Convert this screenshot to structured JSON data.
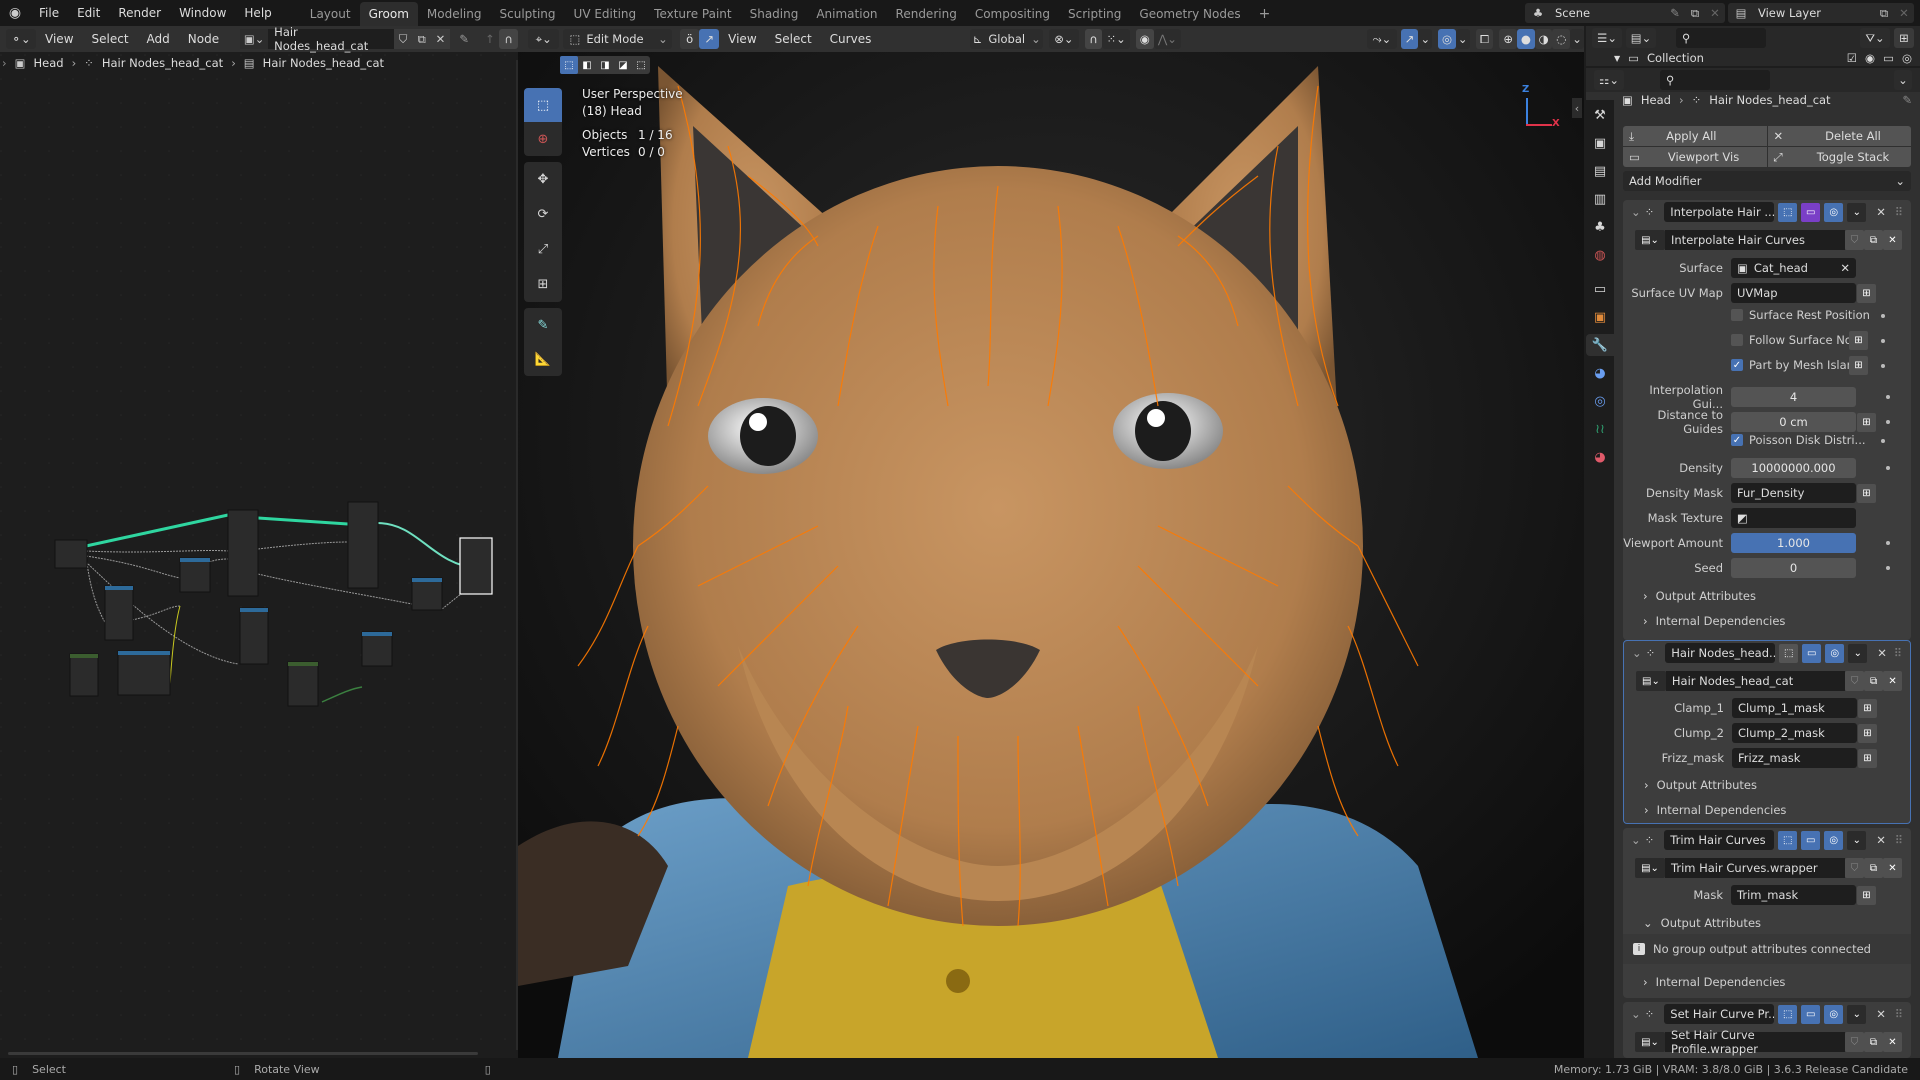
{
  "topbar": {
    "menus": [
      "File",
      "Edit",
      "Render",
      "Window",
      "Help"
    ],
    "workspaces": [
      "Layout",
      "Groom",
      "Modeling",
      "Sculpting",
      "UV Editing",
      "Texture Paint",
      "Shading",
      "Animation",
      "Rendering",
      "Compositing",
      "Scripting",
      "Geometry Nodes"
    ],
    "active_workspace": "Groom",
    "add_workspace": "+",
    "scene": "Scene",
    "view_layer": "View Layer"
  },
  "node_editor": {
    "menus": [
      "View",
      "Select",
      "Add",
      "Node"
    ],
    "node_group": "Hair Nodes_head_cat",
    "breadcrumb": [
      "Head",
      "Hair Nodes_head_cat",
      "Hair Nodes_head_cat"
    ]
  },
  "viewport": {
    "mode": "Edit Mode",
    "menus": [
      "View",
      "Select",
      "Curves"
    ],
    "orientation": "Global",
    "overlay": {
      "view_name": "User Perspective",
      "object_info": "(18) Head",
      "stats": [
        {
          "label": "Objects",
          "value": "1 / 16"
        },
        {
          "label": "Vertices",
          "value": "0 / 0"
        }
      ]
    },
    "axis": {
      "z": "Z",
      "x": "X"
    },
    "tools": [
      "select-box",
      "cursor",
      "move",
      "rotate",
      "scale",
      "transform",
      "annotate",
      "measure"
    ]
  },
  "outliner": {
    "collection": "Collection",
    "search_placeholder": ""
  },
  "properties": {
    "breadcrumb": [
      "Head",
      "Hair Nodes_head_cat"
    ],
    "actions": {
      "apply_all": "Apply All",
      "delete_all": "Delete All",
      "viewport_vis": "Viewport Vis",
      "toggle_stack": "Toggle Stack",
      "add_modifier": "Add Modifier"
    },
    "modifiers": [
      {
        "name": "Interpolate Hair ...",
        "node_group": "Interpolate Hair Curves",
        "fields": {
          "surface_label": "Surface",
          "surface": "Cat_head",
          "uvmap_label": "Surface UV Map",
          "uvmap": "UVMap",
          "rest_label": "Surface Rest Position",
          "rest": false,
          "follow_label": "Follow Surface Nor...",
          "follow": false,
          "islands_label": "Part by Mesh Islands",
          "islands": true,
          "guides_label": "Interpolation Gui...",
          "guides": "4",
          "distance_label": "Distance to Guides",
          "distance": "0 cm",
          "poisson_label": "Poisson Disk Distri...",
          "poisson": true,
          "density_label": "Density",
          "density": "10000000.000",
          "density_mask_label": "Density Mask",
          "density_mask": "Fur_Density",
          "mask_texture_label": "Mask Texture",
          "mask_texture": "",
          "viewport_amount_label": "Viewport Amount",
          "viewport_amount": "1.000",
          "seed_label": "Seed",
          "seed": "0"
        },
        "output_attributes": "Output Attributes",
        "internal_dependencies": "Internal Dependencies"
      },
      {
        "name": "Hair Nodes_head...",
        "node_group": "Hair Nodes_head_cat",
        "fields": [
          {
            "label": "Clamp_1",
            "value": "Clump_1_mask"
          },
          {
            "label": "Clump_2",
            "value": "Clump_2_mask"
          },
          {
            "label": "Frizz_mask",
            "value": "Frizz_mask"
          }
        ],
        "output_attributes": "Output Attributes",
        "internal_dependencies": "Internal Dependencies"
      },
      {
        "name": "Trim Hair Curves",
        "node_group": "Trim Hair Curves.wrapper",
        "fields": [
          {
            "label": "Mask",
            "value": "Trim_mask"
          }
        ],
        "output_attributes": "Output Attributes",
        "info": "No group output attributes connected",
        "internal_dependencies": "Internal Dependencies"
      },
      {
        "name": "Set Hair Curve Pr...",
        "node_group": "Set Hair Curve Profile.wrapper"
      }
    ]
  },
  "statusbar": {
    "left_hint": "Select",
    "middle_hint": "Rotate View",
    "right_info": "Memory: 1.73 GiB | VRAM: 3.8/8.0 GiB | 3.6.3 Release Candidate"
  },
  "colors": {
    "accent": "#4772b3",
    "hair_orange": "#ff7a00",
    "viewport_purple": "#7a3fc7",
    "node_link_green": "#2fd6a0"
  }
}
